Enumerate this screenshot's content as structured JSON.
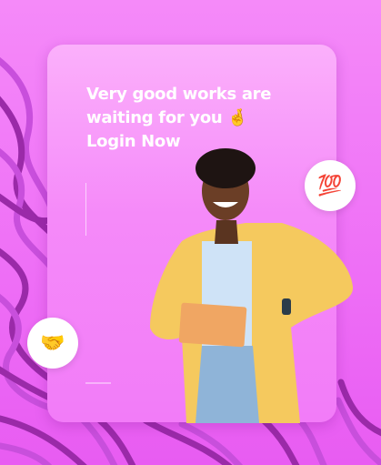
{
  "card": {
    "headline_lines": [
      "Very good works are",
      "waiting for you 🤞",
      "Login Now"
    ]
  },
  "badges": {
    "hundred_emoji": "💯",
    "handshake_emoji": "🤝"
  },
  "colors": {
    "background": "#f27cf8",
    "wave_dark": "#9a2aa8",
    "wave_light": "#c84fdc",
    "card": "#f79cfa"
  }
}
